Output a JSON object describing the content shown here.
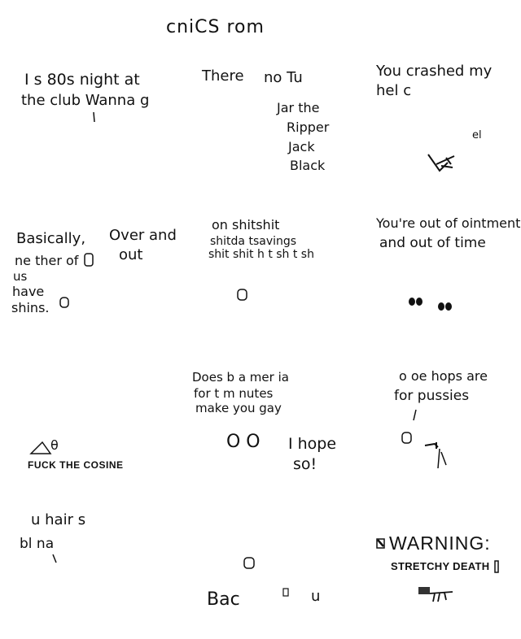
{
  "title": "cniCS rom",
  "panels": [
    {
      "id": "p1",
      "lines": [
        "I s 80s night at",
        "the club  Wanna g"
      ]
    },
    {
      "id": "p2",
      "heading_left": "There",
      "heading_right": "no Tu",
      "list": [
        "Jar the",
        "Ripper",
        "Jack",
        "Black"
      ]
    },
    {
      "id": "p3",
      "lines": [
        "You crashed my",
        "hel c"
      ],
      "small": "el"
    },
    {
      "id": "p4",
      "lines": [
        "Basically,",
        "ne ther of",
        "us",
        "have",
        "shins."
      ],
      "side": [
        "Over and",
        "out"
      ]
    },
    {
      "id": "p5",
      "lines": [
        "on shitshit",
        "shitda    tsavings",
        "shit shit  h t sh t sh"
      ]
    },
    {
      "id": "p6",
      "lines": [
        "You're out of ointment",
        "and out of time"
      ]
    },
    {
      "id": "p7",
      "caption": "FUCK THE COSINE",
      "symbol": "θ"
    },
    {
      "id": "p8",
      "lines": [
        "Does b    a mer ia",
        "for t    m nutes",
        "make you gay"
      ],
      "reply": [
        "I hope",
        "so!"
      ],
      "eyes": "O O"
    },
    {
      "id": "p9",
      "lines": [
        "o oe  hops are",
        "for  pussies"
      ]
    },
    {
      "id": "p10",
      "lines": [
        "u hair s",
        "bl    na"
      ]
    },
    {
      "id": "p11",
      "lines": [
        "Bac"
      ],
      "trail": "u"
    },
    {
      "id": "p12",
      "warning": "WARNING:",
      "sub": "STRETCHY DEATH"
    }
  ]
}
